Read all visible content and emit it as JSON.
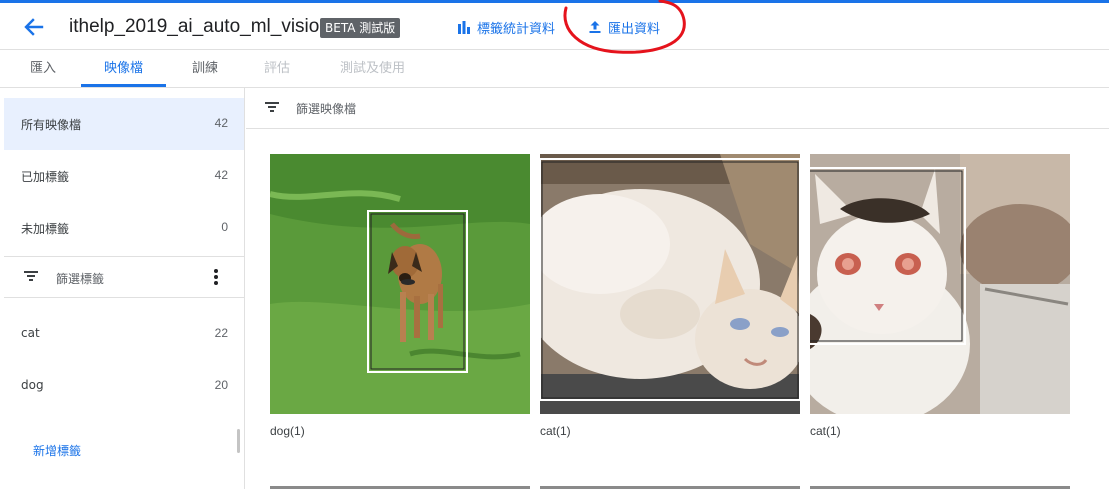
{
  "header": {
    "title": "ithelp_2019_ai_auto_ml_vision",
    "beta_badge": "BETA 測試版",
    "actions": [
      {
        "label": "標籤統計資料",
        "icon": "bar-chart-icon"
      },
      {
        "label": "匯出資料",
        "icon": "upload-icon"
      }
    ]
  },
  "tabs": [
    {
      "label": "匯入",
      "state": "normal"
    },
    {
      "label": "映像檔",
      "state": "active"
    },
    {
      "label": "訓練",
      "state": "normal"
    },
    {
      "label": "評估",
      "state": "disabled"
    },
    {
      "label": "測試及使用",
      "state": "disabled"
    }
  ],
  "sidebar": {
    "image_filters": [
      {
        "label": "所有映像檔",
        "count": "42",
        "selected": true
      },
      {
        "label": "已加標籤",
        "count": "42",
        "selected": false
      },
      {
        "label": "未加標籤",
        "count": "0",
        "selected": false
      }
    ],
    "label_filter_title": "篩選標籤",
    "labels": [
      {
        "label": "cat",
        "count": "22"
      },
      {
        "label": "dog",
        "count": "20"
      }
    ],
    "add_label": "新增標籤"
  },
  "main": {
    "filter_title": "篩選映像檔",
    "images": [
      {
        "caption": "dog(1)",
        "subject": "dog"
      },
      {
        "caption": "cat(1)",
        "subject": "cat"
      },
      {
        "caption": "cat(1)",
        "subject": "cat"
      }
    ]
  },
  "colors": {
    "accent": "#1a73e8",
    "beta_badge_bg": "#5f6368",
    "selected_row_bg": "#e8f0fe",
    "annotation": "#e5131c"
  }
}
